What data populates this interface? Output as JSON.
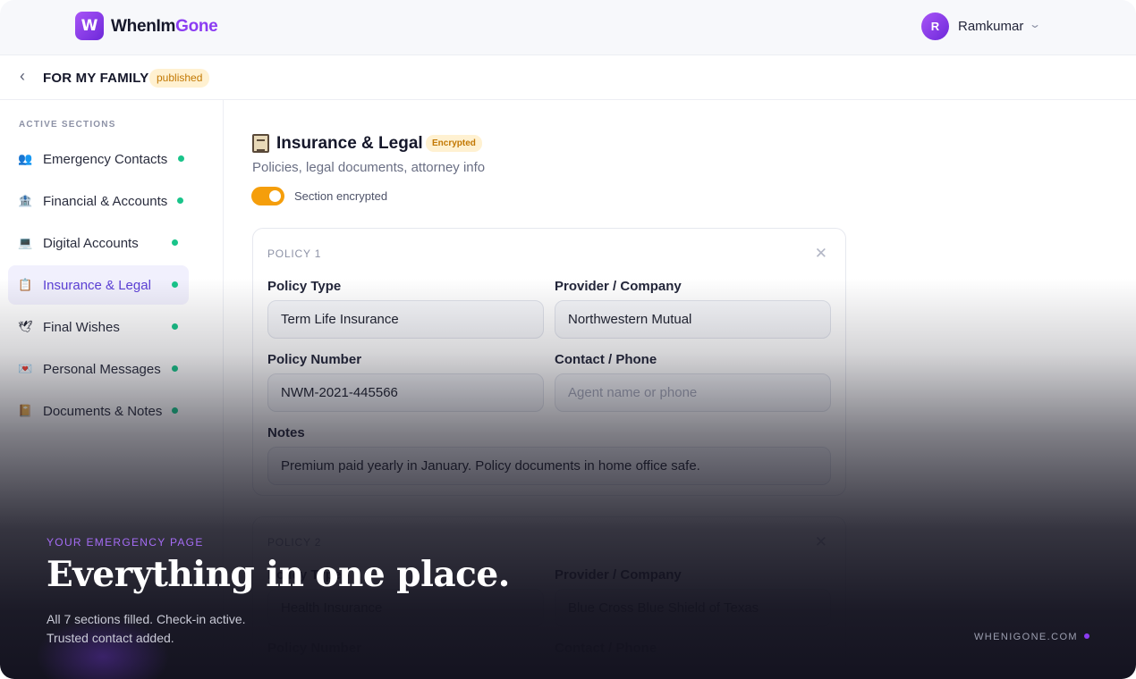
{
  "brand": {
    "logo_letter": "W",
    "name_part1": "WhenIm",
    "name_part2": "Gone",
    "accent_color": "#8b3cf2"
  },
  "user": {
    "initial": "R",
    "name": "Ramkumar"
  },
  "page": {
    "title": "FOR MY FAMILY",
    "status": "published"
  },
  "sidebar": {
    "heading": "ACTIVE SECTIONS",
    "items": [
      {
        "label": "Emergency Contacts",
        "icon": "people-icon",
        "glyph": "👥",
        "complete": true
      },
      {
        "label": "Financial & Accounts",
        "icon": "bank-icon",
        "glyph": "🏦",
        "complete": true
      },
      {
        "label": "Digital Accounts",
        "icon": "laptop-icon",
        "glyph": "💻",
        "complete": true
      },
      {
        "label": "Insurance & Legal",
        "icon": "clipboard-icon",
        "glyph": "📋",
        "complete": true,
        "active": true
      },
      {
        "label": "Final Wishes",
        "icon": "dove-icon",
        "glyph": "🕊",
        "complete": true
      },
      {
        "label": "Personal Messages",
        "icon": "heart-letter-icon",
        "glyph": "💌",
        "complete": true
      },
      {
        "label": "Documents & Notes",
        "icon": "notebook-icon",
        "glyph": "📔",
        "complete": true
      }
    ]
  },
  "section": {
    "title": "Insurance & Legal",
    "badge": "Encrypted",
    "subtitle": "Policies, legal documents, attorney info",
    "toggle_label": "Section encrypted",
    "encrypted": true
  },
  "policies": [
    {
      "heading": "POLICY 1",
      "labels": {
        "type": "Policy Type",
        "provider": "Provider / Company",
        "number": "Policy Number",
        "contact": "Contact / Phone",
        "notes": "Notes"
      },
      "type": "Term Life Insurance",
      "provider": "Northwestern Mutual",
      "number": "NWM-2021-445566",
      "contact": "",
      "contact_placeholder": "Agent name or phone",
      "notes": "Premium paid yearly in January. Policy documents in home office safe."
    },
    {
      "heading": "POLICY 2",
      "labels": {
        "type": "Policy Type",
        "provider": "Provider / Company",
        "number": "Policy Number",
        "contact": "Contact / Phone"
      },
      "type": "Health Insurance",
      "provider": "Blue Cross Blue Shield of Texas"
    }
  ],
  "promo": {
    "eyebrow": "YOUR EMERGENCY PAGE",
    "headline": "Everything in one place.",
    "line1": "All 7 sections filled. Check-in active.",
    "line2": "Trusted contact added.",
    "site": "WHENIGONE.COM"
  }
}
